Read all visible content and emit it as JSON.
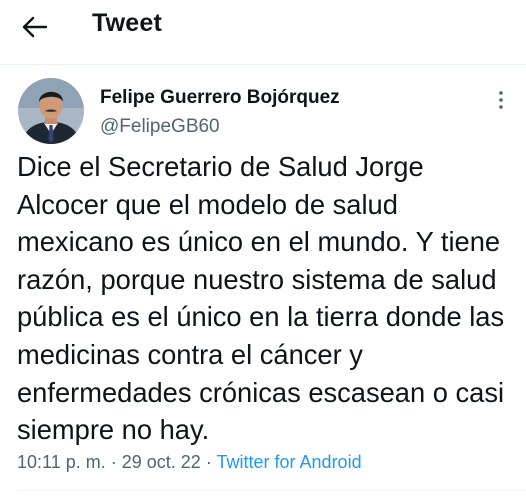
{
  "header": {
    "title": "Tweet",
    "back_icon": "arrow-left-icon"
  },
  "tweet": {
    "author_name": "Felipe Guerrero Bojórquez",
    "author_handle": "@FelipeGB60",
    "text": "Dice el Secretario de Salud Jorge Alcocer que el modelo de salud mexicano es único en el mundo. Y tiene razón, porque nuestro sistema de salud pública es el único en la tierra donde las medicinas contra el cáncer y enfermedades crónicas escasean o casi siempre no hay.",
    "time": "10:11 p. m.",
    "separator": "·",
    "date": "29 oct. 22",
    "source": "Twitter for Android",
    "more_icon": "more-vertical-icon"
  },
  "colors": {
    "text": "#0f1419",
    "secondary": "#536471",
    "link": "#1d9bf0",
    "divider": "#eff3f4"
  }
}
